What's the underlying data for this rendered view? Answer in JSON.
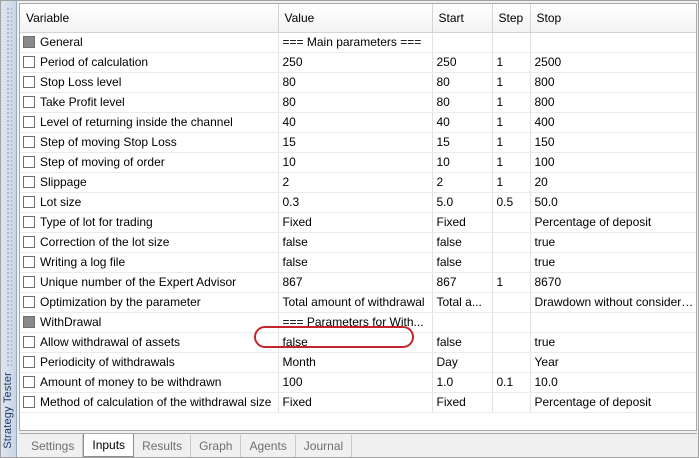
{
  "window": {
    "side_title": "Strategy Tester"
  },
  "columns": [
    "Variable",
    "Value",
    "Start",
    "Step",
    "Stop"
  ],
  "rows": [
    {
      "check": "grey",
      "name": "General",
      "value": "=== Main parameters ===",
      "start": "",
      "step": "",
      "stop": ""
    },
    {
      "check": "box",
      "name": "Period of calculation",
      "value": "250",
      "start": "250",
      "step": "1",
      "stop": "2500"
    },
    {
      "check": "box",
      "name": "Stop Loss level",
      "value": "80",
      "start": "80",
      "step": "1",
      "stop": "800"
    },
    {
      "check": "box",
      "name": "Take Profit level",
      "value": "80",
      "start": "80",
      "step": "1",
      "stop": "800"
    },
    {
      "check": "box",
      "name": "Level of returning inside the channel",
      "value": "40",
      "start": "40",
      "step": "1",
      "stop": "400"
    },
    {
      "check": "box",
      "name": "Step of moving Stop Loss",
      "value": "15",
      "start": "15",
      "step": "1",
      "stop": "150"
    },
    {
      "check": "box",
      "name": "Step of moving of order",
      "value": "10",
      "start": "10",
      "step": "1",
      "stop": "100"
    },
    {
      "check": "box",
      "name": "Slippage",
      "value": "2",
      "start": "2",
      "step": "1",
      "stop": "20"
    },
    {
      "check": "box",
      "name": "Lot size",
      "value": "0.3",
      "start": "5.0",
      "step": "0.5",
      "stop": "50.0"
    },
    {
      "check": "box",
      "name": "Type of lot for trading",
      "value": "Fixed",
      "start": "Fixed",
      "step": "",
      "stop": "Percentage of deposit"
    },
    {
      "check": "box",
      "name": "Correction of the lot size",
      "value": "false",
      "start": "false",
      "step": "",
      "stop": "true"
    },
    {
      "check": "box",
      "name": "Writing a log file",
      "value": "false",
      "start": "false",
      "step": "",
      "stop": "true"
    },
    {
      "check": "box",
      "name": "Unique number of the Expert Advisor",
      "value": "867",
      "start": "867",
      "step": "1",
      "stop": "8670"
    },
    {
      "check": "box",
      "name": "Optimization by the parameter",
      "value": "Total amount of withdrawal",
      "start": "Total a...",
      "step": "",
      "stop": "Drawdown without considera..."
    },
    {
      "check": "grey",
      "name": "WithDrawal",
      "value": "=== Parameters for With...",
      "start": "",
      "step": "",
      "stop": ""
    },
    {
      "check": "box",
      "name": "Allow withdrawal of assets",
      "value": "false",
      "start": "false",
      "step": "",
      "stop": "true"
    },
    {
      "check": "box",
      "name": "Periodicity of withdrawals",
      "value": "Month",
      "start": "Day",
      "step": "",
      "stop": "Year"
    },
    {
      "check": "box",
      "name": "Amount of money to be withdrawn",
      "value": "100",
      "start": "1.0",
      "step": "0.1",
      "stop": "10.0"
    },
    {
      "check": "box",
      "name": "Method of calculation of the withdrawal size",
      "value": "Fixed",
      "start": "Fixed",
      "step": "",
      "stop": "Percentage of deposit"
    }
  ],
  "tabs": [
    {
      "label": "Settings",
      "active": false
    },
    {
      "label": "Inputs",
      "active": true
    },
    {
      "label": "Results",
      "active": false
    },
    {
      "label": "Graph",
      "active": false
    },
    {
      "label": "Agents",
      "active": false
    },
    {
      "label": "Journal",
      "active": false
    }
  ],
  "colors": {
    "highlight": "#c4252b"
  }
}
